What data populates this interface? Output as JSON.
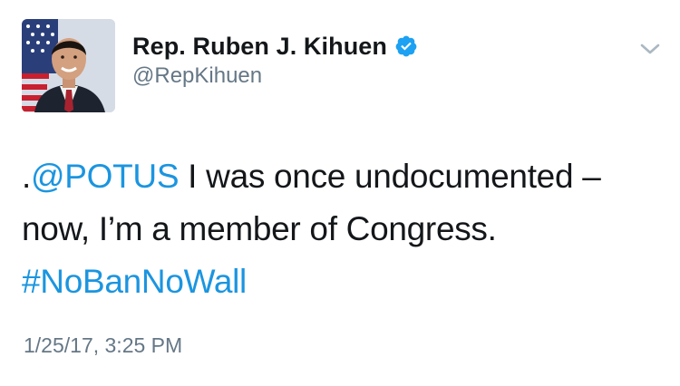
{
  "author": {
    "display_name": "Rep. Ruben J. Kihuen",
    "handle": "@RepKihuen",
    "verified": true,
    "avatar_icon": "profile-photo"
  },
  "tweet": {
    "prefix": ".",
    "mention": "@POTUS",
    "text_line_1": " I was once undocumented –",
    "text_line_2": "now, I’m a member of Congress.",
    "hashtag": "#NoBanNoWall"
  },
  "timestamp": "1/25/17, 3:25 PM",
  "colors": {
    "link": "#1b95e0",
    "verified": "#1da1f2",
    "secondary_text": "#657786",
    "primary_text": "#14171a"
  },
  "icons": {
    "verified": "verified-badge-icon",
    "menu": "chevron-down-icon"
  }
}
